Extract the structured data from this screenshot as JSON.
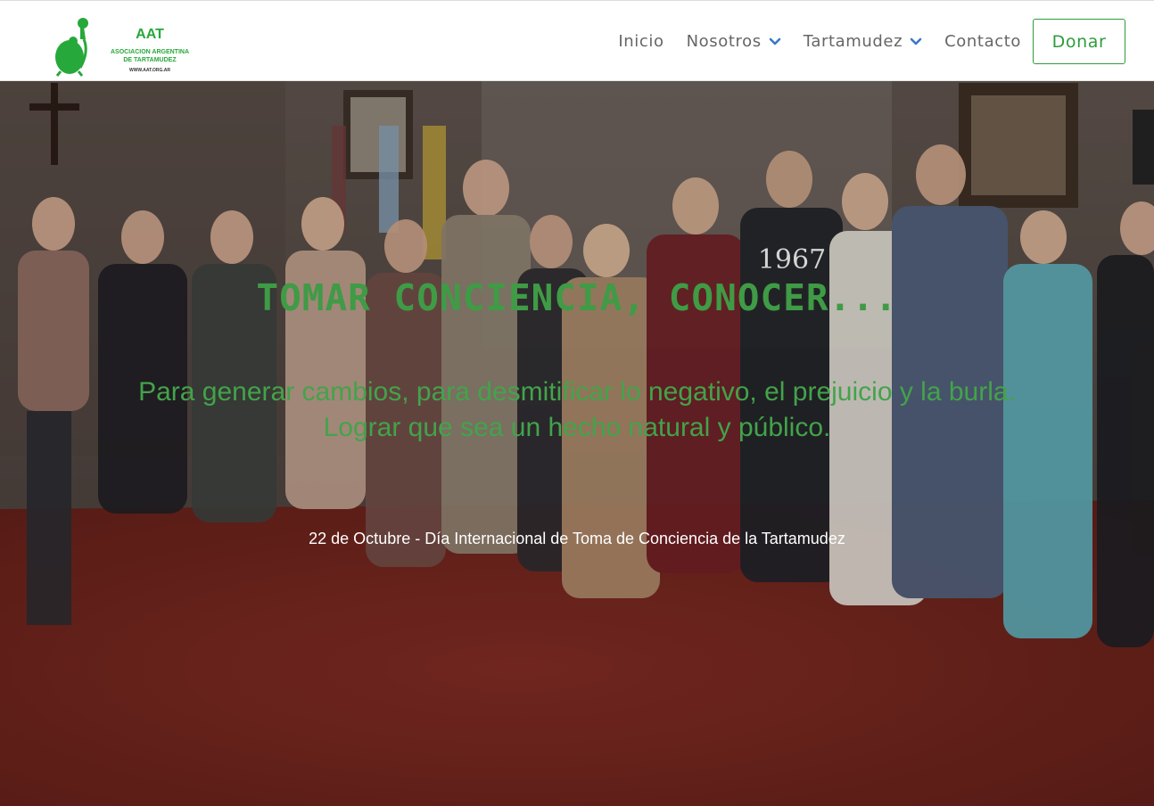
{
  "header": {
    "logo": {
      "abbr": "AAT",
      "name_line1": "ASOCIACION ARGENTINA",
      "name_line2": "DE TARTAMUDEZ",
      "url": "WWW.AAT.ORG.AR",
      "color": "#27a83a"
    },
    "nav": [
      {
        "label": "Inicio",
        "has_dropdown": false
      },
      {
        "label": "Nosotros",
        "has_dropdown": true
      },
      {
        "label": "Tartamudez",
        "has_dropdown": true
      },
      {
        "label": "Contacto",
        "has_dropdown": false
      }
    ],
    "donate_label": "Donar",
    "accent_color": "#2e9c3b",
    "chevron_color": "#3a78c9"
  },
  "hero": {
    "title": "TOMAR CONCIENCIA, CONOCER...",
    "subtitle_line1": "Para generar cambios, para desmitificar lo negativo, el prejuicio y la burla.",
    "subtitle_line2": "Lograr que sea un hecho natural y público.",
    "date_text": "22 de Octubre - Día Internacional de Toma de Conciencia de la Tartamudez",
    "shirt_text": "1967"
  }
}
